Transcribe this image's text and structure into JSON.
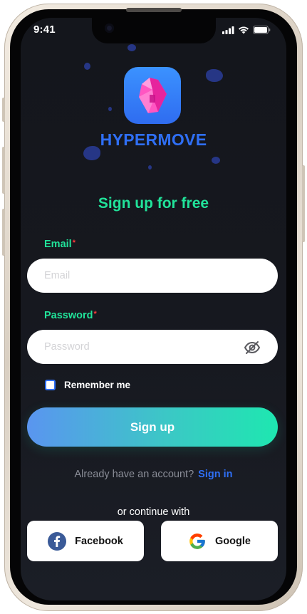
{
  "status_bar": {
    "time": "9:41"
  },
  "brand": {
    "name": "HYPERMOVE"
  },
  "heading": "Sign up for free",
  "form": {
    "email_label": "Email",
    "email_placeholder": "Email",
    "email_value": "",
    "password_label": "Password",
    "password_placeholder": "Password",
    "password_value": "",
    "required_marker": "*",
    "remember_label": "Remember me",
    "remember_checked": false,
    "submit_label": "Sign up"
  },
  "account_prompt": {
    "text": "Already have an account?",
    "link_label": "Sign in"
  },
  "social": {
    "heading": "or continue with",
    "facebook_label": "Facebook",
    "google_label": "Google"
  },
  "colors": {
    "accent_green": "#21e39a",
    "brand_blue": "#2f6ff5",
    "background": "#16181f"
  }
}
